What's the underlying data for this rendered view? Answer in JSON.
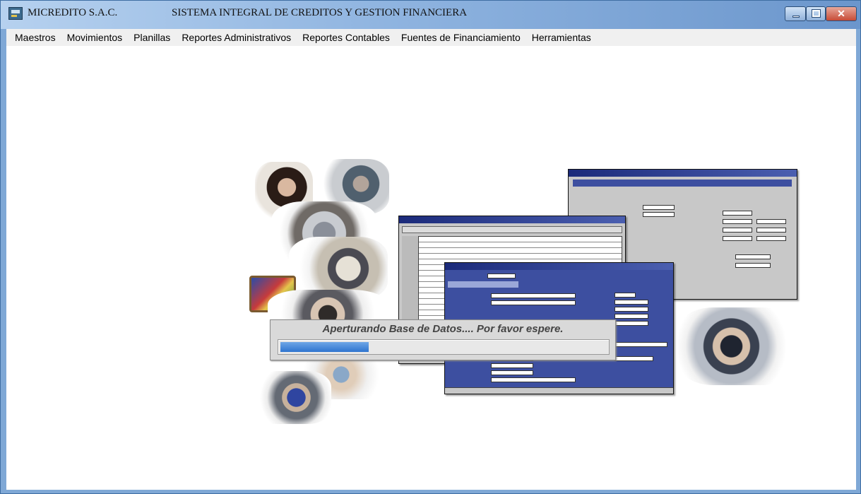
{
  "window": {
    "company": "MICREDITO S.A.C.",
    "system_title": "SISTEMA INTEGRAL DE CREDITOS Y GESTION FINANCIERA",
    "app_icon": "app-window-icon",
    "controls": {
      "minimize": "minimize-icon",
      "maximize": "maximize-icon",
      "close": "close-icon"
    }
  },
  "menu": [
    {
      "label": "Maestros"
    },
    {
      "label": "Movimientos"
    },
    {
      "label": "Planillas"
    },
    {
      "label": "Reportes Administrativos"
    },
    {
      "label": "Reportes Contables"
    },
    {
      "label": "Fuentes de Financiamiento"
    },
    {
      "label": "Herramientas"
    }
  ],
  "progress": {
    "message": "Aperturando Base de Datos.... Por favor espere.",
    "value": 0.27
  },
  "colors": {
    "titlebar_start": "#b6d1ef",
    "titlebar_end": "#6b96cc",
    "menubar": "#f0f0f0",
    "progress_fill": "#2e74cf"
  }
}
